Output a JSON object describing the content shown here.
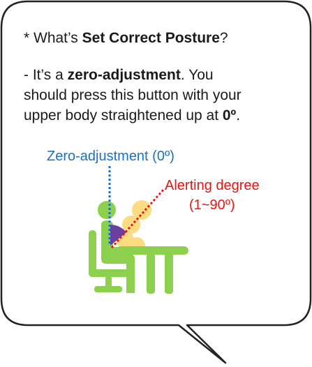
{
  "bubble": {
    "line1_prefix": "* What’s ",
    "line1_bold": "Set Correct Posture",
    "line1_suffix": "?",
    "line2_prefix": " - It’s a ",
    "line2_bold": "zero-adjustment",
    "line2_suffix": ". You",
    "line3": "should press this button with your",
    "line4_prefix": "upper body straightened up at ",
    "line4_bold": "0º",
    "line4_suffix": "."
  },
  "diagram": {
    "zero_label": "Zero-adjustment (0º)",
    "alert_label": "Alerting degree",
    "alert_range": "(1~90º)"
  },
  "colors": {
    "zero_line": "#1a6fc9",
    "alert_line": "#ee1111",
    "figure_green": "#8dd04e",
    "ghost_yellow": "#fcd76a",
    "angle_purple": "#6a3fa0"
  },
  "icons": {
    "person": "person-at-desk-icon",
    "chair": "chair-icon",
    "desk": "desk-icon"
  }
}
